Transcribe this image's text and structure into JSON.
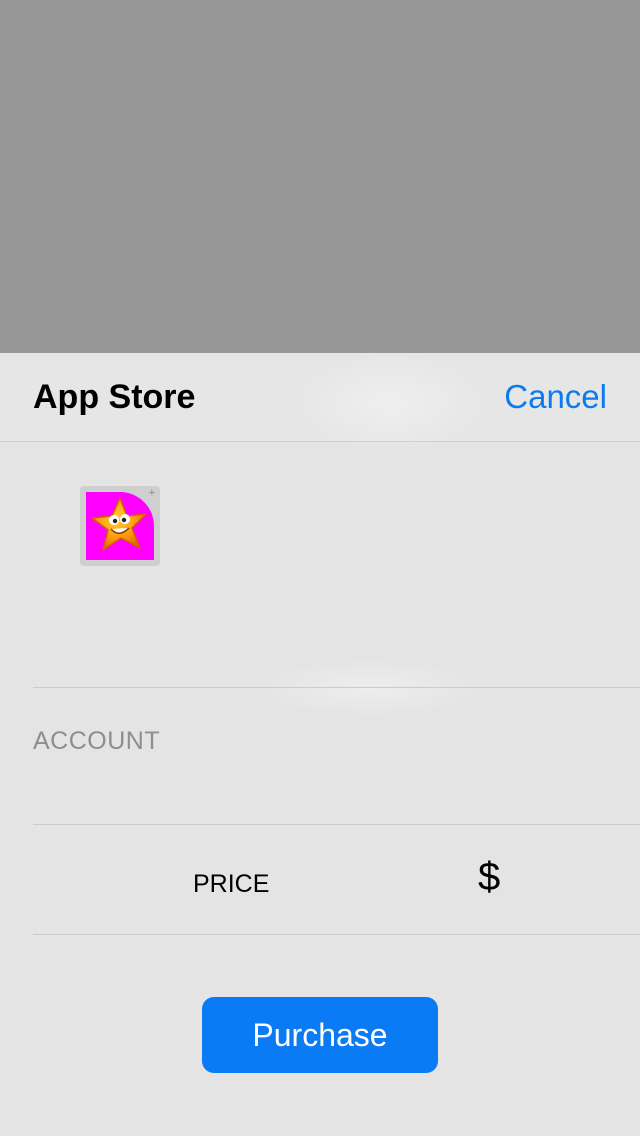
{
  "sheet": {
    "title": "App Store",
    "cancel_label": "Cancel"
  },
  "product": {
    "icon": "starfish-app-icon"
  },
  "account": {
    "label": "ACCOUNT"
  },
  "price": {
    "label": "PRICE",
    "value": "$"
  },
  "purchase_label": "Purchase",
  "colors": {
    "accent": "#0a7af5",
    "overlay": "#979797",
    "sheet": "#e4e4e4",
    "icon_bg": "#ff00ff"
  }
}
